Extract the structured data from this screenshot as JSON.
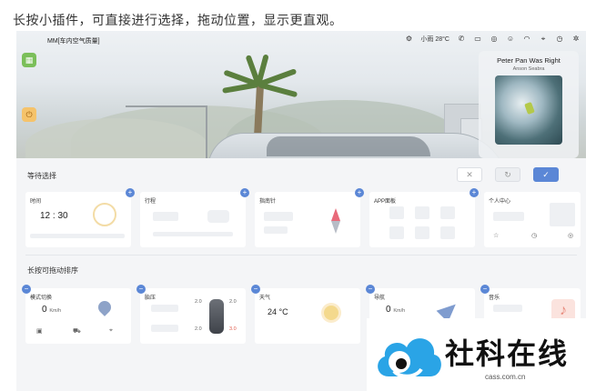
{
  "caption": "长按小插件，可直接进行选择，拖动位置，显示更直观。",
  "topbar": {
    "title": "MM[车内空气质量]",
    "weather": "小雨 28°C"
  },
  "music": {
    "title": "Peter Pan Was Right",
    "artist": "Anson Seabra"
  },
  "waiting": {
    "title": "等待选择",
    "widgets": [
      {
        "label": "时间",
        "value": "12 : 30"
      },
      {
        "label": "行程"
      },
      {
        "label": "指南针"
      },
      {
        "label": "APP面板"
      },
      {
        "label": "个人中心"
      }
    ]
  },
  "sortable": {
    "title": "长按可拖动排序",
    "widgets": [
      {
        "label": "模式切换",
        "speed": "0",
        "unit": "Km/h"
      },
      {
        "label": "胎压",
        "values": [
          "2.0",
          "2.0",
          "2.0",
          "3.0"
        ]
      },
      {
        "label": "天气",
        "value": "24 °C"
      },
      {
        "label": "导航",
        "speed": "0",
        "unit": "Km/h"
      },
      {
        "label": "音乐"
      }
    ]
  },
  "watermark": {
    "text": "社科在线",
    "url": "cass.com.cn"
  },
  "colors": {
    "accent": "#5b87d6",
    "warn": "#e05a4a",
    "apps": "#7bbf5a",
    "power": "#f5c36b"
  }
}
